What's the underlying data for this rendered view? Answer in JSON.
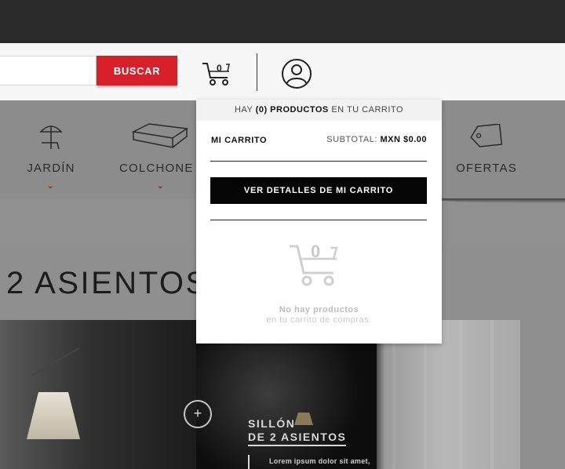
{
  "header": {
    "search": {
      "value": "",
      "placeholder": ""
    },
    "search_button": "BUSCAR",
    "cart_count": "0"
  },
  "categories": [
    {
      "label": "JARDÍN",
      "icon": "umbrella-icon"
    },
    {
      "label": "COLCHONE",
      "icon": "mattress-icon"
    },
    {
      "label": "OFERTAS",
      "icon": "tag-icon"
    }
  ],
  "section": {
    "title": "2 ASIENTOS"
  },
  "product": {
    "title_line1": "SILLÓN",
    "title_line2": "DE 2 ASIENTOS",
    "description": "Lorem ipsum dolor sit amet,",
    "plus": "+"
  },
  "cart_dropdown": {
    "head_prefix": "HAY",
    "head_count": "(0) PRODUCTOS",
    "head_suffix": "EN TU CARRITO",
    "my_cart": "MI CARRITO",
    "subtotal_label": "SUBTOTAL:",
    "subtotal_value": "MXN $0.00",
    "details_button": "VER DETALLES DE MI CARRITO",
    "empty_count": "0",
    "empty_line1": "No hay productos",
    "empty_line2": "en tu carrito de compras."
  },
  "colors": {
    "accent_red": "#d8202a",
    "topbar": "#2a2a2a",
    "button_black": "#050505"
  }
}
